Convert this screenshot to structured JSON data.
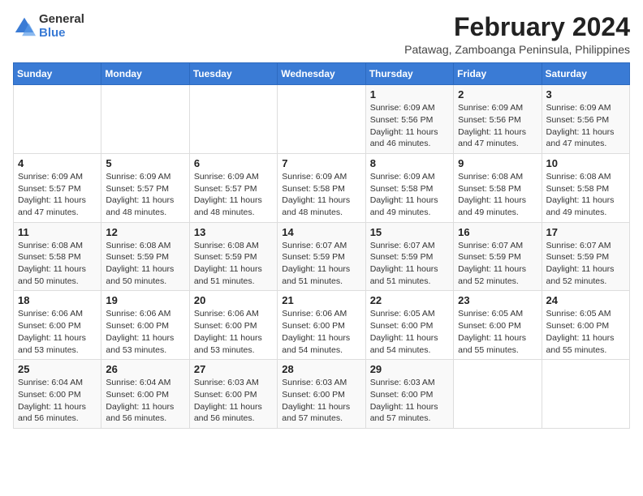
{
  "logo": {
    "general": "General",
    "blue": "Blue"
  },
  "title": {
    "month_year": "February 2024",
    "subtitle": "Patawag, Zamboanga Peninsula, Philippines"
  },
  "days_of_week": [
    "Sunday",
    "Monday",
    "Tuesday",
    "Wednesday",
    "Thursday",
    "Friday",
    "Saturday"
  ],
  "weeks": [
    [
      {
        "day": "",
        "info": ""
      },
      {
        "day": "",
        "info": ""
      },
      {
        "day": "",
        "info": ""
      },
      {
        "day": "",
        "info": ""
      },
      {
        "day": "1",
        "info": "Sunrise: 6:09 AM\nSunset: 5:56 PM\nDaylight: 11 hours\nand 46 minutes."
      },
      {
        "day": "2",
        "info": "Sunrise: 6:09 AM\nSunset: 5:56 PM\nDaylight: 11 hours\nand 47 minutes."
      },
      {
        "day": "3",
        "info": "Sunrise: 6:09 AM\nSunset: 5:56 PM\nDaylight: 11 hours\nand 47 minutes."
      }
    ],
    [
      {
        "day": "4",
        "info": "Sunrise: 6:09 AM\nSunset: 5:57 PM\nDaylight: 11 hours\nand 47 minutes."
      },
      {
        "day": "5",
        "info": "Sunrise: 6:09 AM\nSunset: 5:57 PM\nDaylight: 11 hours\nand 48 minutes."
      },
      {
        "day": "6",
        "info": "Sunrise: 6:09 AM\nSunset: 5:57 PM\nDaylight: 11 hours\nand 48 minutes."
      },
      {
        "day": "7",
        "info": "Sunrise: 6:09 AM\nSunset: 5:58 PM\nDaylight: 11 hours\nand 48 minutes."
      },
      {
        "day": "8",
        "info": "Sunrise: 6:09 AM\nSunset: 5:58 PM\nDaylight: 11 hours\nand 49 minutes."
      },
      {
        "day": "9",
        "info": "Sunrise: 6:08 AM\nSunset: 5:58 PM\nDaylight: 11 hours\nand 49 minutes."
      },
      {
        "day": "10",
        "info": "Sunrise: 6:08 AM\nSunset: 5:58 PM\nDaylight: 11 hours\nand 49 minutes."
      }
    ],
    [
      {
        "day": "11",
        "info": "Sunrise: 6:08 AM\nSunset: 5:58 PM\nDaylight: 11 hours\nand 50 minutes."
      },
      {
        "day": "12",
        "info": "Sunrise: 6:08 AM\nSunset: 5:59 PM\nDaylight: 11 hours\nand 50 minutes."
      },
      {
        "day": "13",
        "info": "Sunrise: 6:08 AM\nSunset: 5:59 PM\nDaylight: 11 hours\nand 51 minutes."
      },
      {
        "day": "14",
        "info": "Sunrise: 6:07 AM\nSunset: 5:59 PM\nDaylight: 11 hours\nand 51 minutes."
      },
      {
        "day": "15",
        "info": "Sunrise: 6:07 AM\nSunset: 5:59 PM\nDaylight: 11 hours\nand 51 minutes."
      },
      {
        "day": "16",
        "info": "Sunrise: 6:07 AM\nSunset: 5:59 PM\nDaylight: 11 hours\nand 52 minutes."
      },
      {
        "day": "17",
        "info": "Sunrise: 6:07 AM\nSunset: 5:59 PM\nDaylight: 11 hours\nand 52 minutes."
      }
    ],
    [
      {
        "day": "18",
        "info": "Sunrise: 6:06 AM\nSunset: 6:00 PM\nDaylight: 11 hours\nand 53 minutes."
      },
      {
        "day": "19",
        "info": "Sunrise: 6:06 AM\nSunset: 6:00 PM\nDaylight: 11 hours\nand 53 minutes."
      },
      {
        "day": "20",
        "info": "Sunrise: 6:06 AM\nSunset: 6:00 PM\nDaylight: 11 hours\nand 53 minutes."
      },
      {
        "day": "21",
        "info": "Sunrise: 6:06 AM\nSunset: 6:00 PM\nDaylight: 11 hours\nand 54 minutes."
      },
      {
        "day": "22",
        "info": "Sunrise: 6:05 AM\nSunset: 6:00 PM\nDaylight: 11 hours\nand 54 minutes."
      },
      {
        "day": "23",
        "info": "Sunrise: 6:05 AM\nSunset: 6:00 PM\nDaylight: 11 hours\nand 55 minutes."
      },
      {
        "day": "24",
        "info": "Sunrise: 6:05 AM\nSunset: 6:00 PM\nDaylight: 11 hours\nand 55 minutes."
      }
    ],
    [
      {
        "day": "25",
        "info": "Sunrise: 6:04 AM\nSunset: 6:00 PM\nDaylight: 11 hours\nand 56 minutes."
      },
      {
        "day": "26",
        "info": "Sunrise: 6:04 AM\nSunset: 6:00 PM\nDaylight: 11 hours\nand 56 minutes."
      },
      {
        "day": "27",
        "info": "Sunrise: 6:03 AM\nSunset: 6:00 PM\nDaylight: 11 hours\nand 56 minutes."
      },
      {
        "day": "28",
        "info": "Sunrise: 6:03 AM\nSunset: 6:00 PM\nDaylight: 11 hours\nand 57 minutes."
      },
      {
        "day": "29",
        "info": "Sunrise: 6:03 AM\nSunset: 6:00 PM\nDaylight: 11 hours\nand 57 minutes."
      },
      {
        "day": "",
        "info": ""
      },
      {
        "day": "",
        "info": ""
      }
    ]
  ]
}
